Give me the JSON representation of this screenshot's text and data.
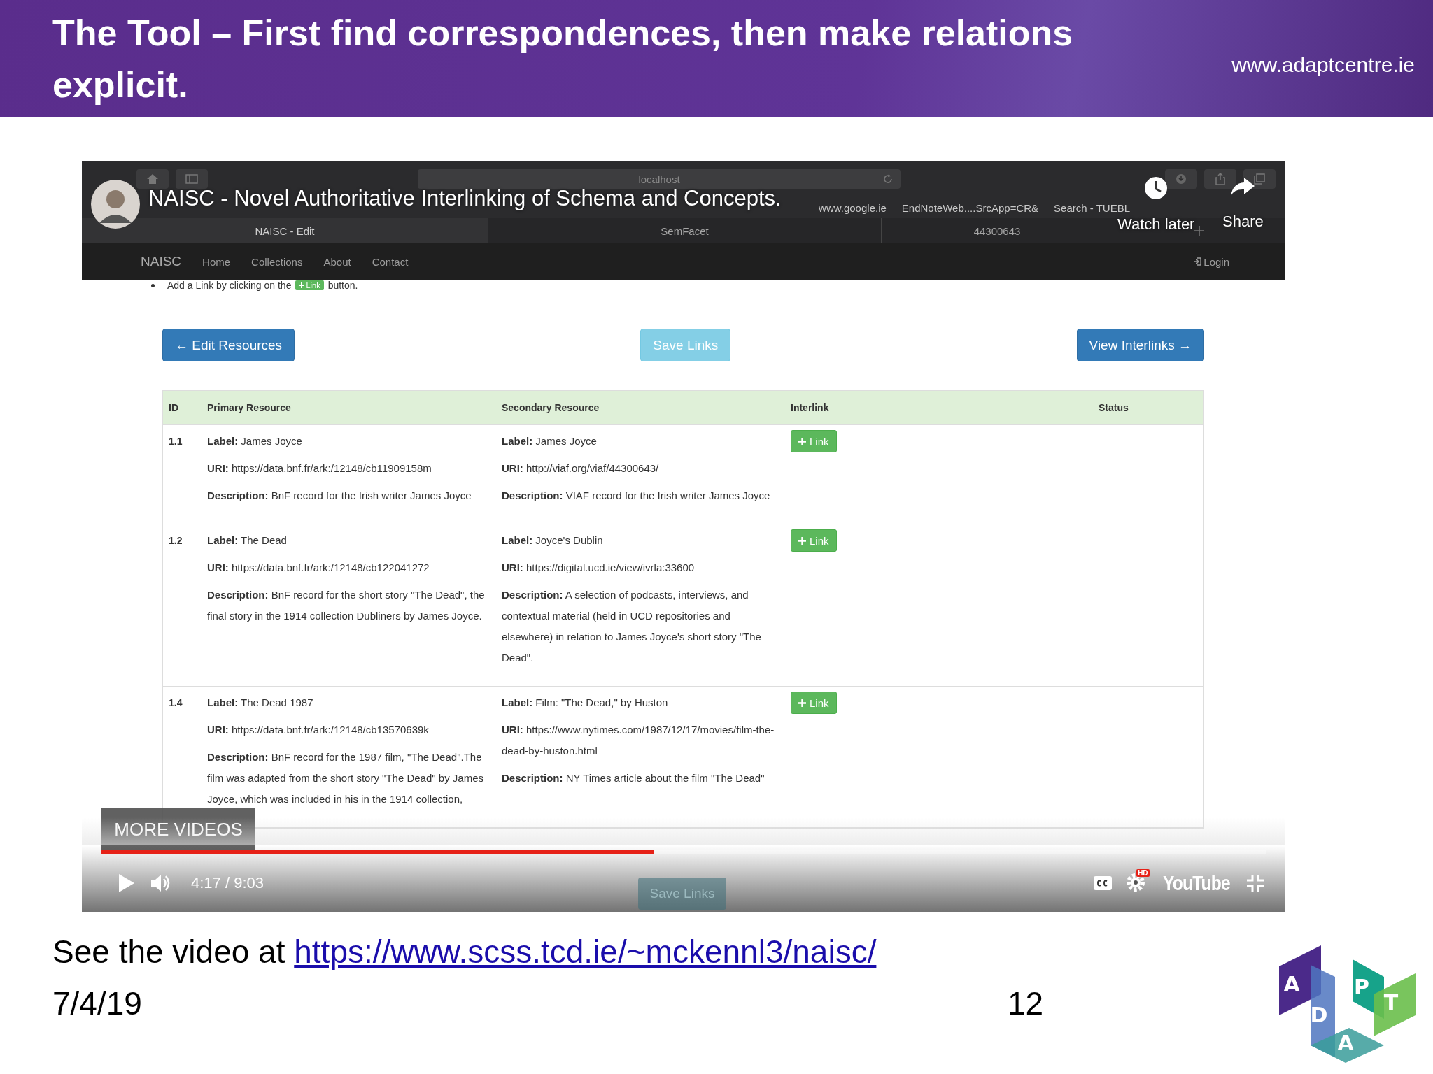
{
  "slide": {
    "title": "The Tool – First find correspondences, then make relations explicit.",
    "site": "www.adaptcentre.ie"
  },
  "video": {
    "title": "NAISC - Novel Authoritative Interlinking of Schema and Concepts.",
    "watch_later": "Watch later",
    "share": "Share",
    "more_videos": "MORE VIDEOS",
    "time": "4:17 / 9:03",
    "level": 0.474,
    "ghost_button": "Save Links",
    "hd": "HD",
    "brand": "YouTube"
  },
  "browser": {
    "address": "localhost",
    "bookmarks": [
      "www.google.ie",
      "EndNoteWeb....SrcApp=CR&",
      "Search - TUEBL"
    ],
    "tabs": [
      {
        "label": "NAISC - Edit",
        "selected": true
      },
      {
        "label": "SemFacet",
        "selected": false
      },
      {
        "label": "44300643",
        "selected": false
      }
    ]
  },
  "site_nav": {
    "brand": "NAISC",
    "links": [
      "Home",
      "Collections",
      "About",
      "Contact"
    ],
    "login": "Login"
  },
  "instruction": {
    "before": "Add a Link by clicking on the",
    "button": "Link",
    "after": "button."
  },
  "buttons": [
    {
      "label": "← Edit Resources",
      "kind": "back"
    },
    {
      "label": "Save Links",
      "kind": "save"
    },
    {
      "label": "View Interlinks →",
      "kind": "forward"
    }
  ],
  "table": {
    "columns": [
      "ID",
      "Primary Resource",
      "Secondary Resource",
      "Interlink",
      "Status"
    ],
    "rows": [
      {
        "id": "1.1",
        "primary": [
          "**Label:** James Joyce",
          "**URI:** https://data.bnf.fr/ark:/12148/cb11909158m",
          "**Description:** BnF record for the Irish writer James Joyce"
        ],
        "secondary": [
          "**Label:** James Joyce",
          "**URI:** http://viaf.org/viaf/44300643/",
          "**Description:** VIAF record for the Irish writer James Joyce"
        ],
        "link": "Link"
      },
      {
        "id": "1.2",
        "primary": [
          "**Label:** The Dead",
          "**URI:** https://data.bnf.fr/ark:/12148/cb122041272",
          "**Description:** BnF record for the short story \"The Dead\", the final story in the 1914 collection Dubliners by James Joyce."
        ],
        "secondary": [
          "**Label:** Joyce's Dublin",
          "**URI:** https://digital.ucd.ie/view/ivrla:33600",
          "**Description:** A selection of podcasts, interviews, and contextual material (held in UCD repositories and elsewhere) in relation to James Joyce's short story \"The Dead\"."
        ],
        "link": "Link"
      },
      {
        "id": "1.4",
        "primary": [
          "**Label:** The Dead 1987",
          "**URI:** https://data.bnf.fr/ark:/12148/cb13570639k",
          "**Description:** BnF record for the 1987 film, \"The Dead\".The film was adapted from the short story \"The Dead\" by James Joyce, which was included in his in the 1914 collection,"
        ],
        "secondary": [
          "**Label:** Film: \"The Dead,\" by Huston",
          "**URI:** https://www.nytimes.com/1987/12/17/movies/film-the-dead-by-huston.html",
          "**Description:** NY Times article about the film \"The Dead\""
        ],
        "link": "Link"
      }
    ]
  },
  "footer": {
    "text": "See the video at",
    "link": "https://www.scss.tcd.ie/~mckennl3/naisc/",
    "date": "7/4/19",
    "page": "12"
  },
  "logo": [
    "A",
    "D",
    "A",
    "P",
    "T"
  ]
}
